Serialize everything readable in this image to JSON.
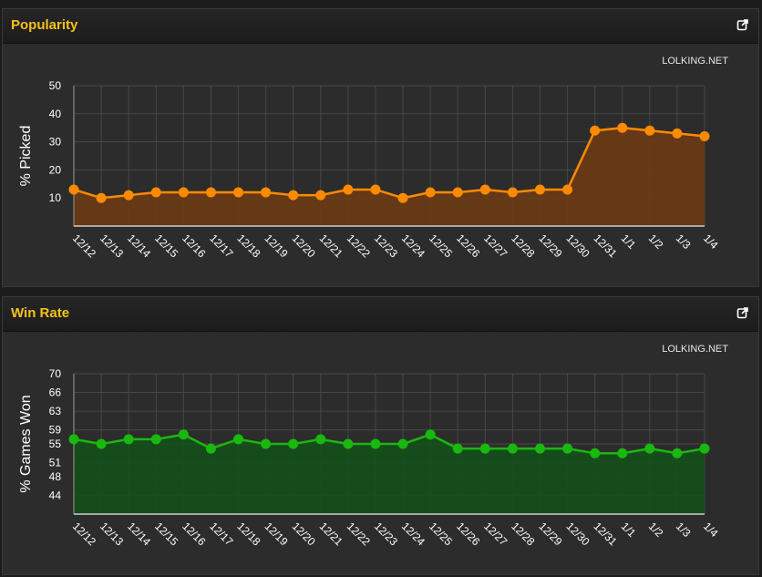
{
  "panels": {
    "popularity": {
      "title": "Popularity",
      "source": "LOLKING.NET"
    },
    "winrate": {
      "title": "Win Rate",
      "source": "LOLKING.NET"
    }
  },
  "icons": {
    "export": "external-link-icon"
  },
  "colors": {
    "title": "#f5c21b",
    "popularity_line": "#ff8a00",
    "popularity_fill": "#6b3a14",
    "winrate_line": "#19b80f",
    "winrate_fill": "#14501a"
  },
  "chart_data": [
    {
      "id": "popularity",
      "type": "area",
      "x": [
        "12/12",
        "12/13",
        "12/14",
        "12/15",
        "12/16",
        "12/17",
        "12/18",
        "12/19",
        "12/20",
        "12/21",
        "12/22",
        "12/23",
        "12/24",
        "12/25",
        "12/26",
        "12/27",
        "12/28",
        "12/29",
        "12/30",
        "12/31",
        "1/1",
        "1/2",
        "1/3",
        "1/4"
      ],
      "values": [
        13,
        10,
        11,
        12,
        12,
        12,
        12,
        12,
        11,
        11,
        13,
        13,
        10,
        12,
        12,
        13,
        12,
        13,
        13,
        34,
        35,
        34,
        33,
        32
      ],
      "ylabel": "% Picked",
      "yticks": [
        10,
        20,
        30,
        40,
        50
      ],
      "ylim": [
        0,
        50
      ],
      "grid": true
    },
    {
      "id": "winrate",
      "type": "area",
      "x": [
        "12/12",
        "12/13",
        "12/14",
        "12/15",
        "12/16",
        "12/17",
        "12/18",
        "12/19",
        "12/20",
        "12/21",
        "12/22",
        "12/23",
        "12/24",
        "12/25",
        "12/26",
        "12/27",
        "12/28",
        "12/29",
        "12/30",
        "12/31",
        "1/1",
        "1/2",
        "1/3",
        "1/4"
      ],
      "values": [
        56,
        55,
        56,
        56,
        57,
        54,
        56,
        55,
        55,
        56,
        55,
        55,
        55,
        57,
        54,
        54,
        54,
        54,
        54,
        53,
        53,
        54,
        53,
        54
      ],
      "ylabel": "% Games Won",
      "yticks": [
        44,
        48,
        51,
        55,
        58,
        62,
        66,
        70
      ],
      "ytick_labels": [
        "44",
        "48",
        "51",
        "55",
        "59",
        "63",
        "66",
        "70"
      ],
      "ylim": [
        40,
        70
      ],
      "grid": true
    }
  ]
}
